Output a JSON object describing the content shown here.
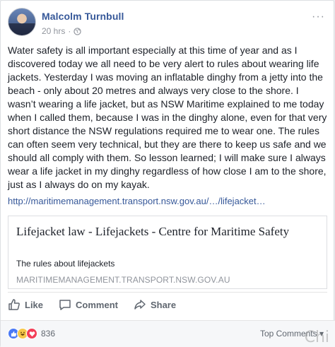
{
  "post": {
    "author": "Malcolm Turnbull",
    "time": "20 hrs",
    "separator": "·",
    "body": "Water safety is all important especially at this time of year and as I discovered today we all need to be very alert to rules about wearing life jackets. Yesterday I was moving an inflatable dinghy from a jetty into the beach - only about 20 metres and always very close to the shore. I wasn’t wearing a life jacket, but as NSW Maritime explained to me today when I called them, because I was in the dinghy alone, even for that very short distance the NSW regulations required me to wear one. The rules can often seem very technical, but they are there to keep us safe and we should all comply with them. So lesson learned; I will make sure I always wear a life jacket in my dinghy regardless of how close I am to the shore, just as I always do on my kayak.",
    "link_text": "http://maritimemanagement.transport.nsw.gov.au/…/lifejacket…"
  },
  "preview": {
    "title": "Lifejacket law - Lifejackets - Centre for Maritime Safety",
    "description": "The rules about lifejackets",
    "domain": "MARITIMEMANAGEMENT.TRANSPORT.NSW.GOV.AU"
  },
  "actions": {
    "like": "Like",
    "comment": "Comment",
    "share": "Share"
  },
  "footer": {
    "reaction_count": "836",
    "top_comments": "Top Comments ▾"
  },
  "watermark": "Chi"
}
